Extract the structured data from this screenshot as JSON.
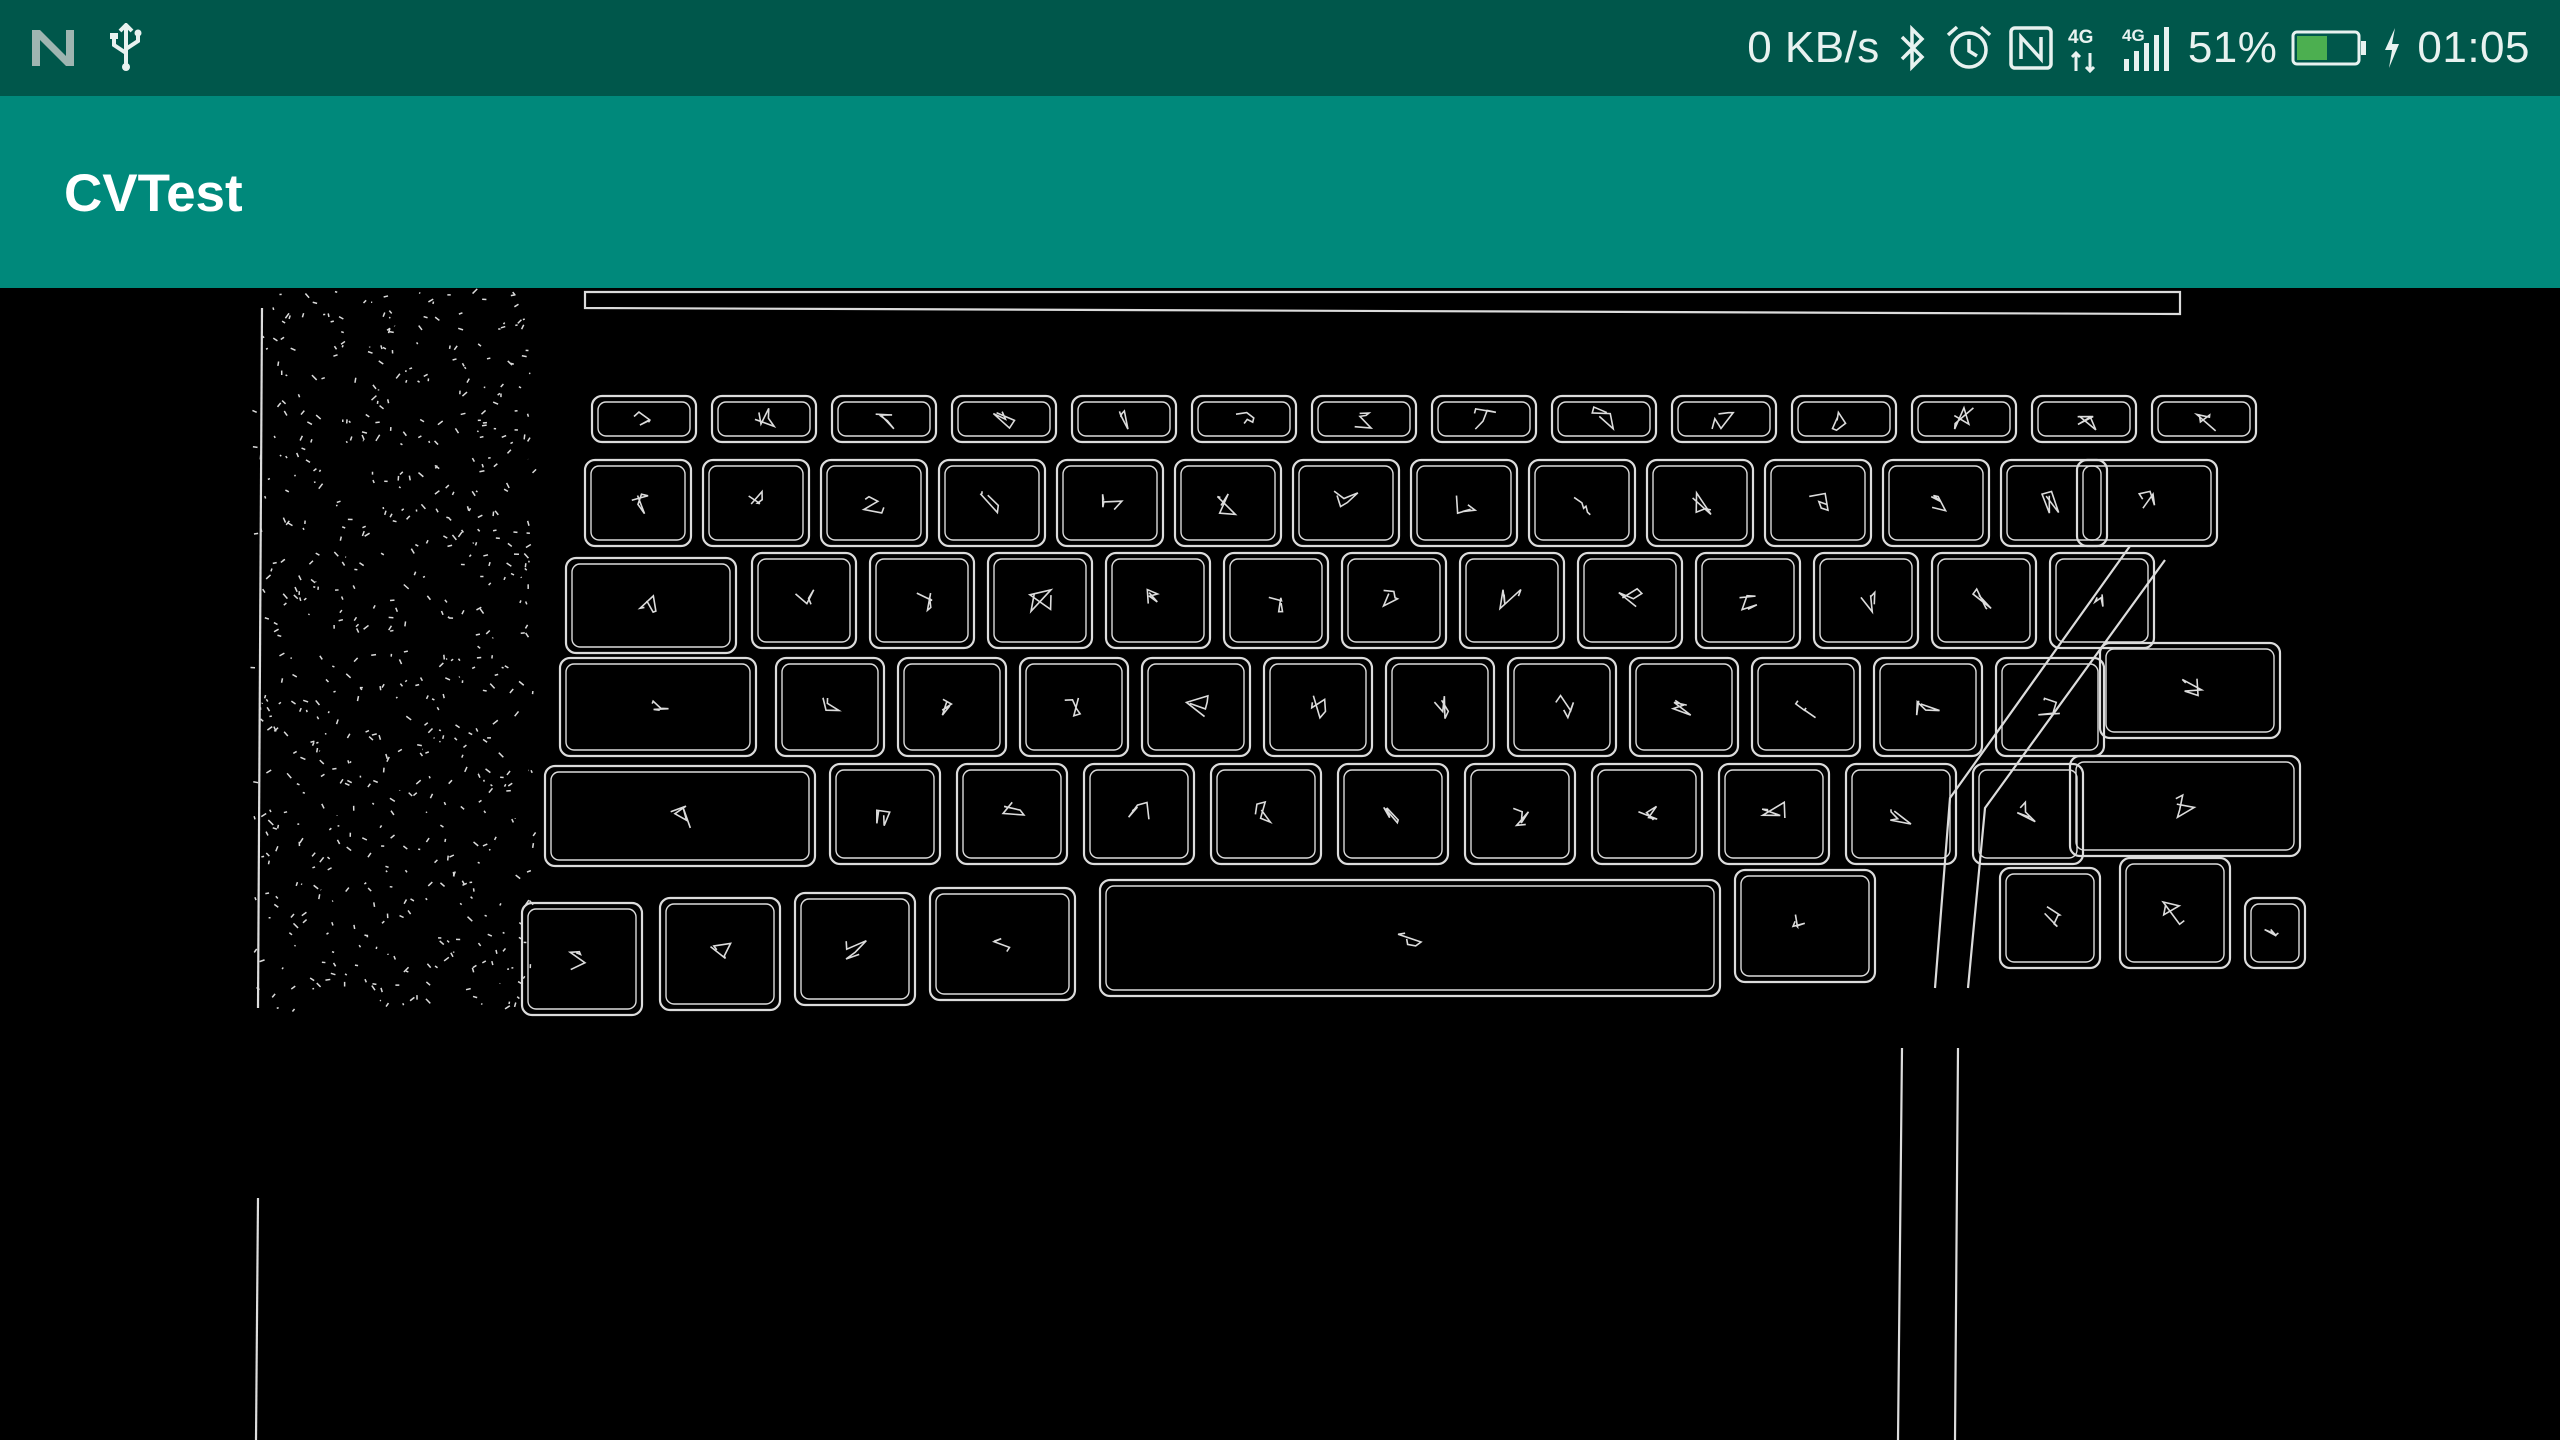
{
  "status_bar": {
    "left_icons": [
      "notification-n-icon",
      "usb-icon"
    ],
    "net_speed": "0 KB/s",
    "right_icons": [
      "bluetooth-icon",
      "alarm-icon",
      "nfc-icon",
      "signal-4g-icon",
      "signal-4g-icon"
    ],
    "battery_percent": "51%",
    "battery_level": 0.51,
    "charging_icon": "charging-bolt-icon",
    "time": "01:05",
    "background_color": "#00574b"
  },
  "app_bar": {
    "title": "CVTest",
    "background_color": "#00897b"
  },
  "camera_view": {
    "content": "edge-detection-preview",
    "stroke_color": "#dddddd",
    "background_color": "#000000"
  }
}
